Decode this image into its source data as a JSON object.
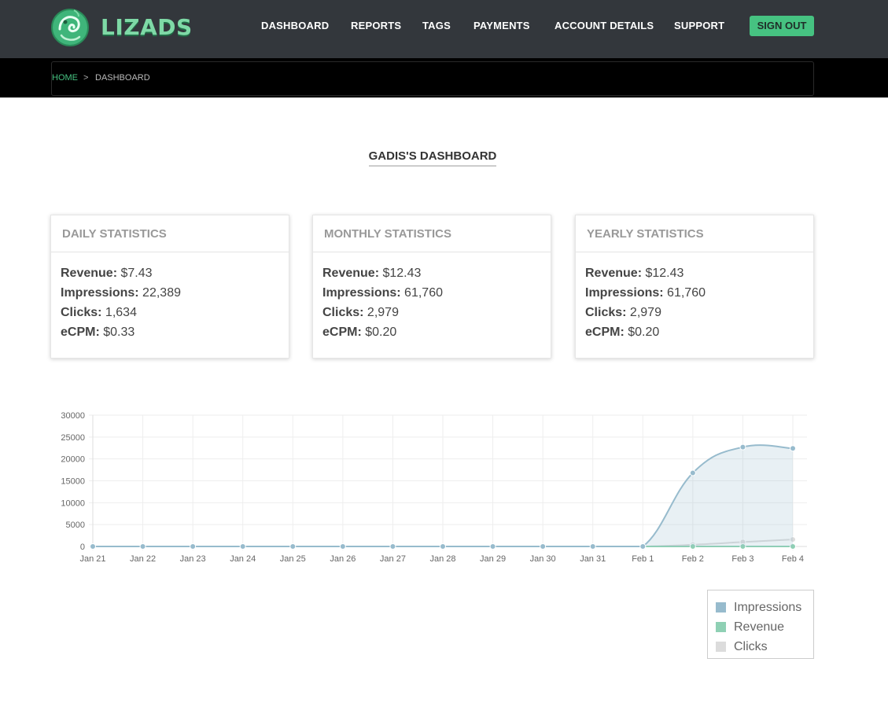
{
  "brand": {
    "name": "LIZADS",
    "logo_icon": "chameleon-logo-icon",
    "accent": "#46c281"
  },
  "nav": {
    "items": [
      {
        "id": "dashboard",
        "label": "DASHBOARD"
      },
      {
        "id": "reports",
        "label": "REPORTS"
      },
      {
        "id": "tags",
        "label": "TAGS"
      },
      {
        "id": "payments",
        "label": "PAYMENTS"
      },
      {
        "id": "account-details",
        "label": "ACCOUNT DETAILS"
      },
      {
        "id": "support",
        "label": "SUPPORT"
      }
    ],
    "signout_label": "SIGN OUT"
  },
  "breadcrumb": {
    "home": "HOME",
    "separator": ">",
    "current": "DASHBOARD"
  },
  "page_title": "GADIS'S DASHBOARD",
  "cards": [
    {
      "id": "daily",
      "title": "DAILY STATISTICS",
      "revenue_label": "Revenue:",
      "revenue": "$7.43",
      "impressions_label": "Impressions:",
      "impressions": "22,389",
      "clicks_label": "Clicks:",
      "clicks": "1,634",
      "ecpm_label": "eCPM:",
      "ecpm": "$0.33"
    },
    {
      "id": "monthly",
      "title": "MONTHLY STATISTICS",
      "revenue_label": "Revenue:",
      "revenue": "$12.43",
      "impressions_label": "Impressions:",
      "impressions": "61,760",
      "clicks_label": "Clicks:",
      "clicks": "2,979",
      "ecpm_label": "eCPM:",
      "ecpm": "$0.20"
    },
    {
      "id": "yearly",
      "title": "YEARLY STATISTICS",
      "revenue_label": "Revenue:",
      "revenue": "$12.43",
      "impressions_label": "Impressions:",
      "impressions": "61,760",
      "clicks_label": "Clicks:",
      "clicks": "2,979",
      "ecpm_label": "eCPM:",
      "ecpm": "$0.20"
    }
  ],
  "chart_data": {
    "type": "line",
    "x": [
      "Jan 21",
      "Jan 22",
      "Jan 23",
      "Jan 24",
      "Jan 25",
      "Jan 26",
      "Jan 27",
      "Jan 28",
      "Jan 29",
      "Jan 30",
      "Jan 31",
      "Feb 1",
      "Feb 2",
      "Feb 3",
      "Feb 4"
    ],
    "ylim": [
      0,
      30000
    ],
    "yticks": [
      0,
      5000,
      10000,
      15000,
      20000,
      25000,
      30000
    ],
    "grid": true,
    "legend_position": "bottom-right",
    "series": [
      {
        "name": "Impressions",
        "color": "#97bbcd",
        "fill": true,
        "values": [
          0,
          0,
          0,
          0,
          0,
          0,
          0,
          0,
          0,
          0,
          0,
          0,
          16800,
          22700,
          22400
        ]
      },
      {
        "name": "Revenue",
        "color": "#8fd0b4",
        "fill": false,
        "values": [
          0,
          0,
          0,
          0,
          0,
          0,
          0,
          0,
          0,
          0,
          0,
          0,
          5,
          7,
          7
        ]
      },
      {
        "name": "Clicks",
        "color": "#dcdcdc",
        "fill": false,
        "values": [
          0,
          0,
          0,
          0,
          0,
          0,
          0,
          0,
          0,
          0,
          0,
          0,
          400,
          1000,
          1600
        ]
      }
    ]
  }
}
